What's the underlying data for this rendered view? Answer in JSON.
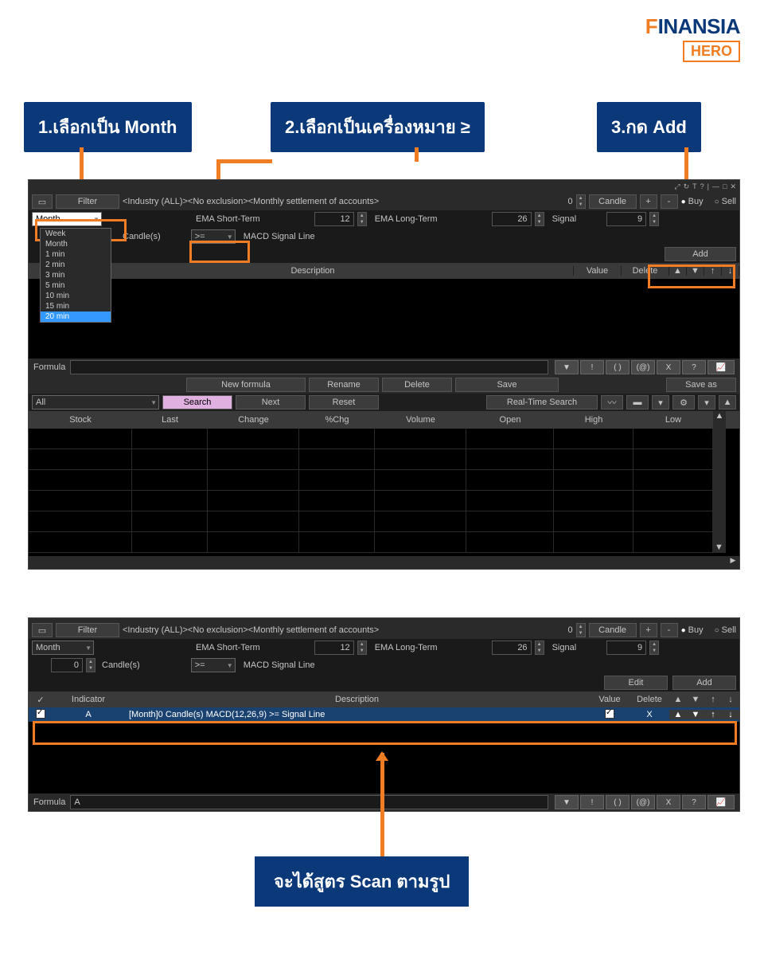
{
  "logo": {
    "prefix": "F",
    "rest": "INANSIA",
    "hero": "HERO"
  },
  "callouts": {
    "c1": "1.เลือกเป็น Month",
    "c2": "2.เลือกเป็นเครื่องหมาย ≥",
    "c3": "3.กด Add",
    "bottom": "จะได้สูตร Scan ตามรูป"
  },
  "toolbar": {
    "filter": "Filter",
    "breadcrumb": "<Industry (ALL)><No exclusion><Monthly settlement of accounts>",
    "zero": "0",
    "candle": "Candle",
    "plus": "+",
    "minus": "-",
    "buy": "Buy",
    "sell": "Sell"
  },
  "params": {
    "month_sel": "Month",
    "dropdown_opts": [
      "Week",
      "Month",
      "1 min",
      "2 min",
      "3 min",
      "5 min",
      "10 min",
      "15 min",
      "20 min"
    ],
    "dropdown_selected": "20 min",
    "candles_label": "Candle(s)",
    "candles_val": "0",
    "ema_short_label": "EMA Short-Term",
    "ema_short_val": "12",
    "ema_long_label": "EMA Long-Term",
    "ema_long_val": "26",
    "signal_label": "Signal",
    "signal_val": "9",
    "op_sel": ">=",
    "macd_label": "MACD Signal Line"
  },
  "buttons": {
    "add": "Add",
    "edit": "Edit",
    "new_formula": "New formula",
    "rename": "Rename",
    "delete": "Delete",
    "save": "Save",
    "save_as": "Save as",
    "search": "Search",
    "next": "Next",
    "reset": "Reset",
    "realtime": "Real-Time Search"
  },
  "cols1": {
    "desc": "Description",
    "value": "Value",
    "delete": "Delete"
  },
  "formula_label": "Formula",
  "fbtns": [
    "▼",
    "!",
    "( )",
    "(@)",
    "X",
    "?"
  ],
  "sel_all": "All",
  "stock_cols": [
    "Stock",
    "Last",
    "Change",
    "%Chg",
    "Volume",
    "Open",
    "High",
    "Low"
  ],
  "app2": {
    "month_val": "Month",
    "result_cols": {
      "check": "✓",
      "indicator": "Indicator",
      "desc": "Description",
      "value": "Value",
      "delete": "Delete"
    },
    "result": {
      "A": "A",
      "desc": "[Month]0 Candle(s) MACD(12,26,9) >= Signal Line",
      "x": "X"
    },
    "formula_val": "A"
  }
}
